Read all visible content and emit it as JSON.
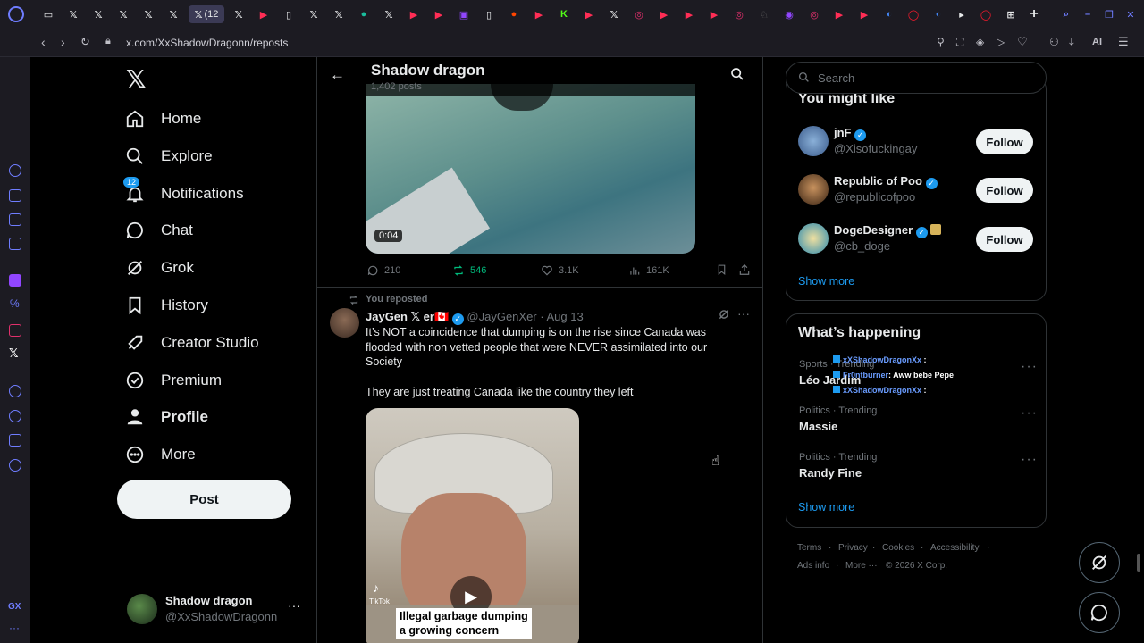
{
  "browser": {
    "url": "x.com/XxShadowDragonn/reposts",
    "active_tab_label": "(12",
    "ai_label": "AI"
  },
  "sidebar": {
    "nav": [
      {
        "label": "Home",
        "icon": "home-icon"
      },
      {
        "label": "Explore",
        "icon": "search-icon"
      },
      {
        "label": "Notifications",
        "icon": "bell-icon",
        "badge": "12"
      },
      {
        "label": "Chat",
        "icon": "chat-icon"
      },
      {
        "label": "Grok",
        "icon": "grok-icon"
      },
      {
        "label": "History",
        "icon": "bookmark-icon"
      },
      {
        "label": "Creator Studio",
        "icon": "rocket-icon"
      },
      {
        "label": "Premium",
        "icon": "verified-badge-icon"
      },
      {
        "label": "Profile",
        "icon": "person-icon"
      },
      {
        "label": "More",
        "icon": "more-circle-icon"
      }
    ],
    "post_label": "Post",
    "account": {
      "name": "Shadow dragon",
      "handle": "@XxShadowDragonn"
    }
  },
  "header": {
    "title": "Shadow dragon",
    "subtitle": "1,402 posts"
  },
  "video1": {
    "duration": "0:04"
  },
  "actions1": {
    "replies": "210",
    "reposts": "546",
    "likes": "3.1K",
    "views": "161K"
  },
  "tweet": {
    "repost_label": "You reposted",
    "author": "JayGen 𝕏 er🇨🇦",
    "handle": "@JayGenXer",
    "date": "· Aug 13",
    "text1": "It’s NOT a coincidence that dumping is on the rise since Canada was flooded with non vetted people that were NEVER assimilated into our Society",
    "text2": "They are just treating Canada like the country they left",
    "caption_line1": "Illegal garbage dumping",
    "caption_line2": "a growing concern",
    "tiktok_label": "TikTok"
  },
  "right": {
    "search_placeholder": "Search",
    "might_like_title": "You might like",
    "suggestions": [
      {
        "name": "jnF",
        "handle": "@Xisofuckingay",
        "follow": "Follow"
      },
      {
        "name": "Republic of Poo",
        "handle": "@republicofpoo",
        "follow": "Follow"
      },
      {
        "name": "DogeDesigner",
        "handle": "@cb_doge",
        "follow": "Follow"
      }
    ],
    "show_more": "Show more",
    "happening_title": "What’s happening",
    "trends": [
      {
        "meta": "Sports · Trending",
        "name": "Léo Jardim"
      },
      {
        "meta": "Politics · Trending",
        "name": "Massie"
      },
      {
        "meta": "Politics · Trending",
        "name": "Randy Fine"
      }
    ],
    "show_more2": "Show more",
    "overlay_chat": [
      {
        "user": "xXShadowDragonXx",
        "msg": ":"
      },
      {
        "user": "Fr0ntburner",
        "msg": ": Aww bebe Pepe"
      },
      {
        "user": "xXShadowDragonXx",
        "msg": ":"
      }
    ],
    "footer": {
      "terms": "Terms",
      "privacy": "Privacy",
      "cookies": "Cookies",
      "accessibility": "Accessibility",
      "ads": "Ads info",
      "more": "More ···",
      "copyright": "© 2026 X Corp."
    }
  },
  "colors": {
    "accent": "#1d9bf0",
    "repost_green": "#00ba7c",
    "bg": "#000000"
  }
}
